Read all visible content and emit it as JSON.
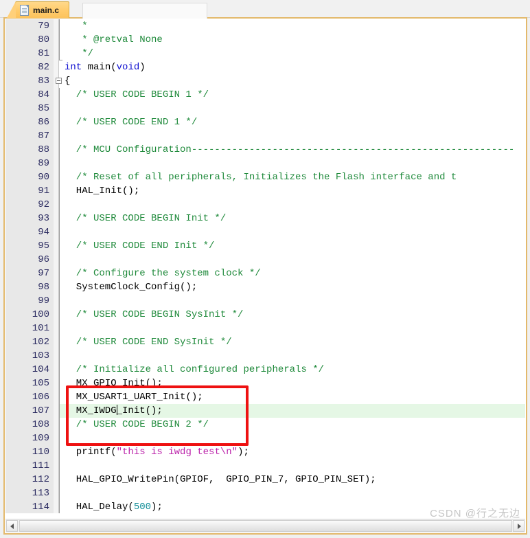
{
  "window": {
    "tab": {
      "label": "main.c",
      "icon": "c-source-file-icon",
      "active": true
    }
  },
  "editor": {
    "language": "c",
    "first_visible_line": 79,
    "last_visible_line": 114,
    "active_line": 107,
    "caret": {
      "line": 107,
      "column": 8
    },
    "colors": {
      "comment": "#1f8a3b",
      "keyword": "#1010d0",
      "string": "#bb22aa",
      "number": "#0f8c96",
      "plain": "#000000",
      "gutter_bg": "#e8e8e8",
      "gutter_fg": "#2b2b60",
      "active_line_bg": "#e5f7e5",
      "frame_border": "#e3b96c",
      "tab_active_bg": "#ffcb6b"
    },
    "lines": [
      {
        "n": "79",
        "tokens": [
          {
            "t": "cmt",
            "s": "   *"
          }
        ]
      },
      {
        "n": "80",
        "tokens": [
          {
            "t": "cmt",
            "s": "   * @retval None"
          }
        ]
      },
      {
        "n": "81",
        "tokens": [
          {
            "t": "cmt",
            "s": "   */"
          }
        ],
        "fold_end": true
      },
      {
        "n": "82",
        "tokens": [
          {
            "t": "kw",
            "s": "int"
          },
          {
            "t": "pln",
            "s": " main("
          },
          {
            "t": "kw",
            "s": "void"
          },
          {
            "t": "pln",
            "s": ")"
          }
        ]
      },
      {
        "n": "83",
        "tokens": [
          {
            "t": "pln",
            "s": "{"
          }
        ],
        "fold_box": true
      },
      {
        "n": "84",
        "tokens": [
          {
            "t": "cmt",
            "s": "  /* USER CODE BEGIN 1 */"
          }
        ]
      },
      {
        "n": "85",
        "tokens": []
      },
      {
        "n": "86",
        "tokens": [
          {
            "t": "cmt",
            "s": "  /* USER CODE END 1 */"
          }
        ]
      },
      {
        "n": "87",
        "tokens": []
      },
      {
        "n": "88",
        "tokens": [
          {
            "t": "cmt",
            "s": "  /* MCU Configuration--------------------------------------------------------"
          }
        ]
      },
      {
        "n": "89",
        "tokens": []
      },
      {
        "n": "90",
        "tokens": [
          {
            "t": "cmt",
            "s": "  /* Reset of all peripherals, Initializes the Flash interface and t"
          }
        ]
      },
      {
        "n": "91",
        "tokens": [
          {
            "t": "pln",
            "s": "  HAL_Init();"
          }
        ]
      },
      {
        "n": "92",
        "tokens": []
      },
      {
        "n": "93",
        "tokens": [
          {
            "t": "cmt",
            "s": "  /* USER CODE BEGIN Init */"
          }
        ]
      },
      {
        "n": "94",
        "tokens": []
      },
      {
        "n": "95",
        "tokens": [
          {
            "t": "cmt",
            "s": "  /* USER CODE END Init */"
          }
        ]
      },
      {
        "n": "96",
        "tokens": []
      },
      {
        "n": "97",
        "tokens": [
          {
            "t": "cmt",
            "s": "  /* Configure the system clock */"
          }
        ]
      },
      {
        "n": "98",
        "tokens": [
          {
            "t": "pln",
            "s": "  SystemClock_Config();"
          }
        ]
      },
      {
        "n": "99",
        "tokens": []
      },
      {
        "n": "100",
        "tokens": [
          {
            "t": "cmt",
            "s": "  /* USER CODE BEGIN SysInit */"
          }
        ]
      },
      {
        "n": "101",
        "tokens": []
      },
      {
        "n": "102",
        "tokens": [
          {
            "t": "cmt",
            "s": "  /* USER CODE END SysInit */"
          }
        ]
      },
      {
        "n": "103",
        "tokens": []
      },
      {
        "n": "104",
        "tokens": [
          {
            "t": "cmt",
            "s": "  /* Initialize all configured peripherals */"
          }
        ]
      },
      {
        "n": "105",
        "tokens": [
          {
            "t": "pln",
            "s": "  MX_GPIO_Init();"
          }
        ]
      },
      {
        "n": "106",
        "tokens": [
          {
            "t": "pln",
            "s": "  MX_USART1_UART_Init();"
          }
        ]
      },
      {
        "n": "107",
        "tokens": [
          {
            "t": "pln",
            "s": "  MX_IWDG"
          },
          {
            "t": "caret",
            "s": ""
          },
          {
            "t": "pln",
            "s": "_Init();"
          }
        ],
        "highlight": true
      },
      {
        "n": "108",
        "tokens": [
          {
            "t": "cmt",
            "s": "  /* USER CODE BEGIN 2 */"
          }
        ]
      },
      {
        "n": "109",
        "tokens": []
      },
      {
        "n": "110",
        "tokens": [
          {
            "t": "pln",
            "s": "  printf("
          },
          {
            "t": "str",
            "s": "\"this is iwdg test\\n\""
          },
          {
            "t": "pln",
            "s": ");"
          }
        ]
      },
      {
        "n": "111",
        "tokens": []
      },
      {
        "n": "112",
        "tokens": [
          {
            "t": "pln",
            "s": "  HAL_GPIO_WritePin(GPIOF,  GPIO_PIN_7, GPIO_PIN_SET);"
          }
        ]
      },
      {
        "n": "113",
        "tokens": []
      },
      {
        "n": "114",
        "tokens": [
          {
            "t": "pln",
            "s": "  HAL_Delay("
          },
          {
            "t": "num",
            "s": "500"
          },
          {
            "t": "pln",
            "s": ");"
          }
        ]
      }
    ]
  },
  "annotation": {
    "type": "red-rectangle",
    "color": "#ee1111",
    "covers_lines": [
      "105",
      "106",
      "107"
    ]
  },
  "scrollbar": {
    "horizontal": {
      "left_arrow": "◀",
      "right_arrow": "▶"
    }
  },
  "watermark": {
    "text": "CSDN @行之无边"
  }
}
